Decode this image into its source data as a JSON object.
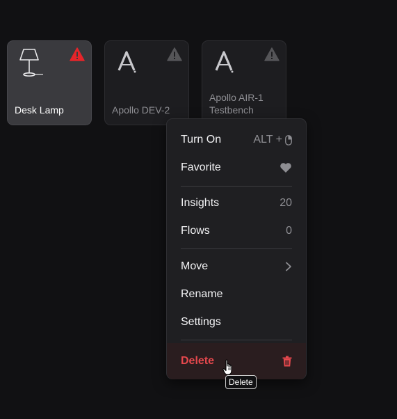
{
  "tiles": [
    {
      "label": "Desk Lamp",
      "icon": "desk-lamp-icon",
      "warning_color": "#e5252a"
    },
    {
      "label": "Apollo DEV-2",
      "icon": "apollo-logo-icon",
      "warning_color": "#555558"
    },
    {
      "label": "Apollo AIR-1 Testbench",
      "icon": "apollo-logo-icon",
      "warning_color": "#555558"
    }
  ],
  "menu": {
    "turn_on": {
      "label": "Turn On",
      "shortcut": "ALT +"
    },
    "favorite": {
      "label": "Favorite"
    },
    "insights": {
      "label": "Insights",
      "count": "20"
    },
    "flows": {
      "label": "Flows",
      "count": "0"
    },
    "move": {
      "label": "Move"
    },
    "rename": {
      "label": "Rename"
    },
    "settings": {
      "label": "Settings"
    },
    "delete": {
      "label": "Delete",
      "color": "#e5484d"
    }
  },
  "tooltip": {
    "text": "Delete"
  },
  "colors": {
    "background": "#111113",
    "tile_active": "#3a3a3e",
    "menu_bg": "#1f1f22",
    "danger": "#e5252a"
  }
}
